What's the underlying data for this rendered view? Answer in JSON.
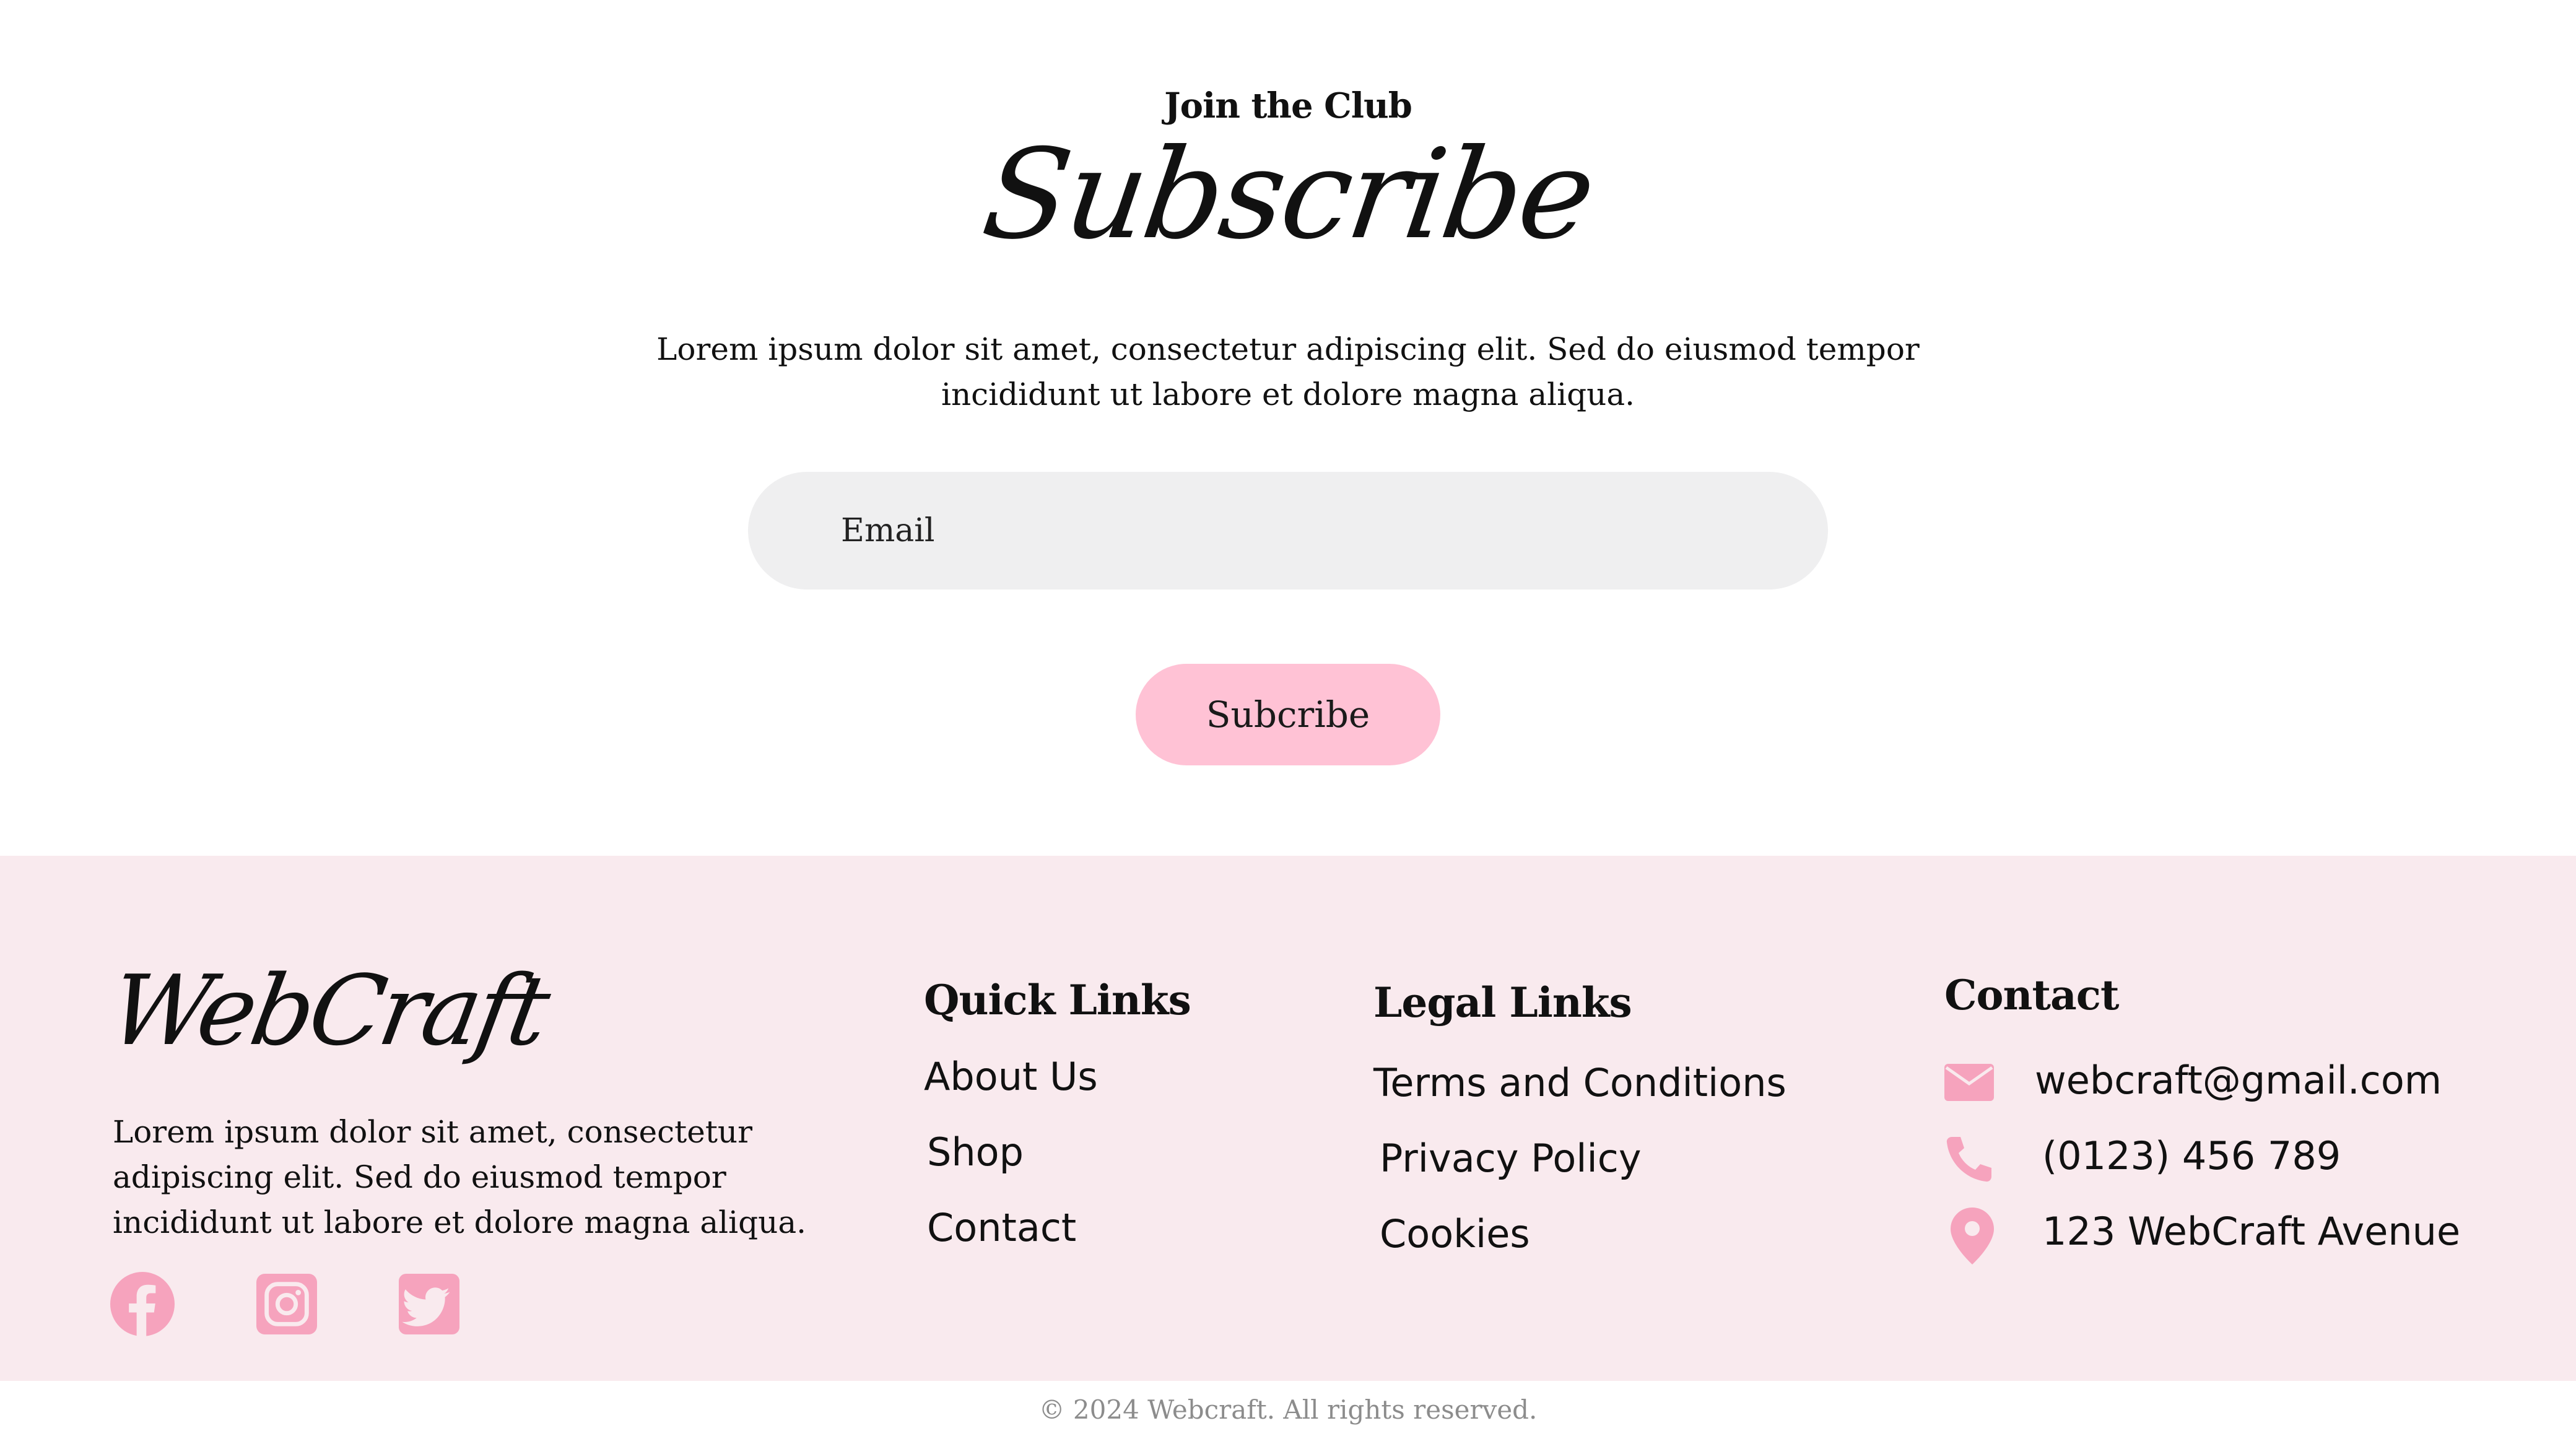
{
  "subscribe": {
    "eyebrow": "Join the Club",
    "title": "Subscribe",
    "description": "Lorem ipsum dolor sit amet, consectetur adipiscing elit. Sed do eiusmod tempor incididunt ut labore et dolore magna aliqua.",
    "email_placeholder": "Email",
    "button_label": "Subcribe"
  },
  "footer": {
    "brand": "WebCraft",
    "brand_description": "Lorem ipsum dolor sit amet, consectetur adipiscing elit. Sed do eiusmod tempor incididunt ut labore et dolore magna aliqua.",
    "social": [
      {
        "icon": "facebook-icon"
      },
      {
        "icon": "instagram-icon"
      },
      {
        "icon": "twitter-icon"
      }
    ],
    "quick_links": {
      "title": "Quick Links",
      "items": [
        "About Us",
        "Shop",
        "Contact"
      ]
    },
    "legal_links": {
      "title": "Legal Links",
      "items": [
        "Terms and Conditions",
        "Privacy Policy",
        "Cookies"
      ]
    },
    "contact": {
      "title": "Contact",
      "email": "webcraft@gmail.com",
      "phone": "(0123) 456 789",
      "address": "123 WebCraft Avenue"
    },
    "copyright": "© 2024 Webcraft. All rights reserved."
  },
  "colors": {
    "accent_pink": "#f6a3bd",
    "button_pink": "#ffc2d5",
    "footer_bg": "#f9eaee",
    "input_bg": "#efeff0"
  }
}
